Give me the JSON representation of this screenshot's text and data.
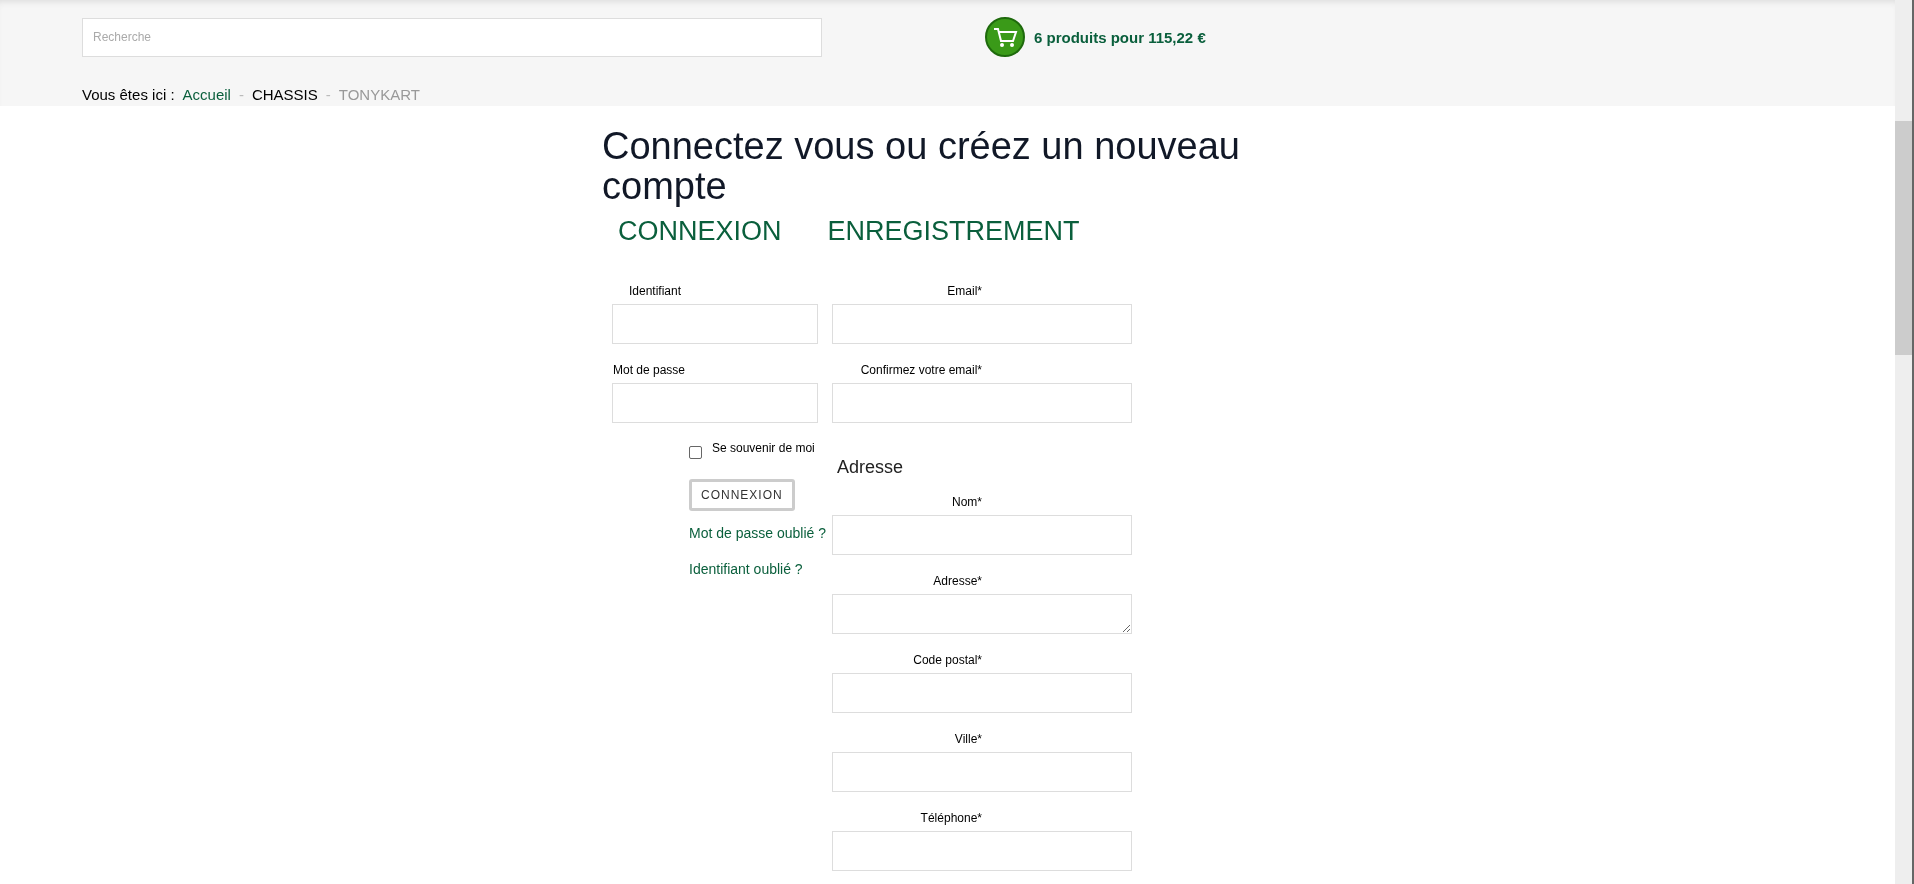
{
  "search": {
    "placeholder": "Recherche"
  },
  "cart": {
    "summary": "6 produits pour 115,22 €"
  },
  "breadcrumb": {
    "label": "Vous êtes ici :",
    "separator": "-",
    "items": [
      {
        "text": "Accueil",
        "kind": "link"
      },
      {
        "text": "CHASSIS",
        "kind": "plain"
      },
      {
        "text": "TONYKART",
        "kind": "muted"
      }
    ]
  },
  "heading": "Connectez vous ou créez un nouveau compte",
  "tabs": [
    {
      "label": "CONNEXION"
    },
    {
      "label": "ENREGISTREMENT"
    }
  ],
  "login": {
    "fields": [
      {
        "label": "Identifiant",
        "kind": "indented"
      },
      {
        "label": "Mot de passe",
        "kind": "flush"
      }
    ],
    "remember": {
      "label": "Se souvenir de moi",
      "checked": false
    },
    "button": "CONNEXION",
    "links": [
      "Mot de passe oublié ?",
      "Identifiant oublié ?"
    ]
  },
  "register": {
    "items": [
      {
        "kind": "input",
        "label": "Email*"
      },
      {
        "kind": "input",
        "label": "Confirmez votre email*"
      },
      {
        "kind": "heading",
        "label": "Adresse"
      },
      {
        "kind": "input",
        "label": "Nom*"
      },
      {
        "kind": "textarea",
        "label": "Adresse*"
      },
      {
        "kind": "input",
        "label": "Code postal*"
      },
      {
        "kind": "input",
        "label": "Ville*"
      },
      {
        "kind": "input",
        "label": "Téléphone*"
      }
    ]
  }
}
